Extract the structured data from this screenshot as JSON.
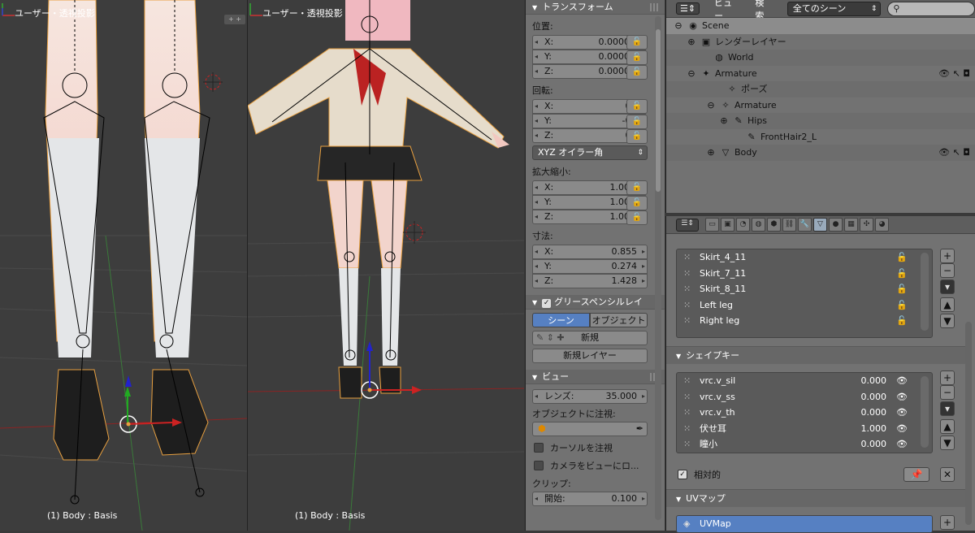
{
  "viewport_left": {
    "title": "ユーザー・透視投影",
    "status": "(1) Body : Basis"
  },
  "viewport_right": {
    "title": "ユーザー・透視投影",
    "status": "(1) Body : Basis"
  },
  "transform": {
    "header": "トランスフォーム",
    "location_label": "位置:",
    "location": [
      {
        "k": "X:",
        "v": "0.00000"
      },
      {
        "k": "Y:",
        "v": "0.00000"
      },
      {
        "k": "Z:",
        "v": "0.00000"
      }
    ],
    "rotation_label": "回転:",
    "rotation": [
      {
        "k": "X:",
        "v": "0°"
      },
      {
        "k": "Y:",
        "v": "-0°"
      },
      {
        "k": "Z:",
        "v": "0°"
      }
    ],
    "rotation_mode": "XYZ オイラー角",
    "scale_label": "拡大縮小:",
    "scale": [
      {
        "k": "X:",
        "v": "1.000"
      },
      {
        "k": "Y:",
        "v": "1.000"
      },
      {
        "k": "Z:",
        "v": "1.000"
      }
    ],
    "dims_label": "寸法:",
    "dims": [
      {
        "k": "X:",
        "v": "0.855"
      },
      {
        "k": "Y:",
        "v": "0.274"
      },
      {
        "k": "Z:",
        "v": "1.428"
      }
    ]
  },
  "grease": {
    "header": "グリースペンシルレイ",
    "scene_tab": "シーン",
    "object_tab": "オブジェクト",
    "new_label": "新規",
    "new_layer": "新規レイヤー"
  },
  "view": {
    "header": "ビュー",
    "lens_label": "レンズ:",
    "lens_value": "35.000",
    "lock_label": "オブジェクトに注視:",
    "lock_cursor": "カーソルを注視",
    "lock_camera": "カメラをビューにロ...",
    "clip_label": "クリップ:",
    "clip_start_label": "開始:",
    "clip_start_value": "0.100"
  },
  "outliner": {
    "menu_view": "ビュー",
    "menu_search": "検索",
    "scene_select": "全てのシーン",
    "rows": [
      {
        "label": "Scene",
        "indent": 8,
        "exp": "⊖",
        "icon": "◉",
        "right": ""
      },
      {
        "label": "レンダーレイヤー",
        "indent": 24,
        "exp": "⊕",
        "icon": "▣",
        "right": ""
      },
      {
        "label": "World",
        "indent": 40,
        "exp": "",
        "icon": "◍",
        "right": ""
      },
      {
        "label": "Armature",
        "indent": 24,
        "exp": "⊖",
        "icon": "✦",
        "right": "👁 ↖ ◘"
      },
      {
        "label": "ポーズ",
        "indent": 56,
        "exp": "",
        "icon": "✧",
        "right": ""
      },
      {
        "label": "Armature",
        "indent": 48,
        "exp": "⊖",
        "icon": "✧",
        "right": ""
      },
      {
        "label": "Hips",
        "indent": 64,
        "exp": "⊕",
        "icon": "✎",
        "right": ""
      },
      {
        "label": "FrontHair2_L",
        "indent": 80,
        "exp": "",
        "icon": "✎",
        "right": ""
      },
      {
        "label": "Body",
        "indent": 48,
        "exp": "⊕",
        "icon": "▽",
        "right": "👁 ↖ ◘"
      }
    ]
  },
  "vertex_groups": {
    "items": [
      "Skirt_4_11",
      "Skirt_7_11",
      "Skirt_8_11",
      "Left leg",
      "Right leg"
    ]
  },
  "shape_keys": {
    "header": "シェイプキー",
    "items": [
      {
        "name": "vrc.v_sil",
        "val": "0.000"
      },
      {
        "name": "vrc.v_ss",
        "val": "0.000"
      },
      {
        "name": "vrc.v_th",
        "val": "0.000"
      },
      {
        "name": "伏せ耳",
        "val": "1.000"
      },
      {
        "name": "瞳小",
        "val": "0.000"
      }
    ],
    "relative_label": "相対的"
  },
  "uv_maps": {
    "header": "UVマップ",
    "items": [
      "UVMap"
    ]
  }
}
